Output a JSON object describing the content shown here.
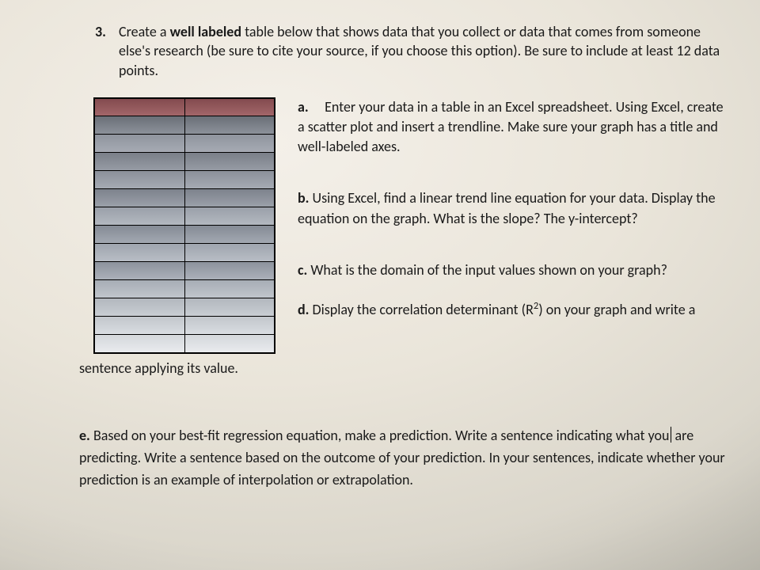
{
  "question_number": "3.",
  "intro_pre": "Create a ",
  "intro_bold": "well labeled",
  "intro_post": " table below that shows data that you collect or data that comes from someone else's research (be sure to cite your source, if you choose this option). Be sure to include at least 12 data points.",
  "parts": {
    "a": {
      "label": "a.",
      "text": "Enter your data in a table in an Excel spreadsheet. Using Excel, create a scatter plot and insert a trendline.  Make sure your graph has a title and well-labeled axes."
    },
    "b": {
      "label": "b.",
      "text": "Using Excel, find a linear trend line equation for your data. Display the equation on the graph.  What is the slope? The y-intercept?"
    },
    "c": {
      "label": "c.",
      "text": "What is the domain of the input values shown on your graph?"
    },
    "d": {
      "label": "d.",
      "text_inline": "Display the correlation determinant (R",
      "text_sup": "2",
      "text_after": ") on your graph and write a",
      "tail": "sentence applying its value."
    },
    "e": {
      "label": "e.",
      "text": "Based on your best-fit regression equation, make a prediction. Write a sentence indicating what you",
      "text2": "are predicting. Write a sentence based on the outcome of your prediction. In your sentences, indicate whether your prediction is an example of interpolation or extrapolation."
    }
  },
  "table": {
    "rows": 14,
    "cols": 2
  }
}
